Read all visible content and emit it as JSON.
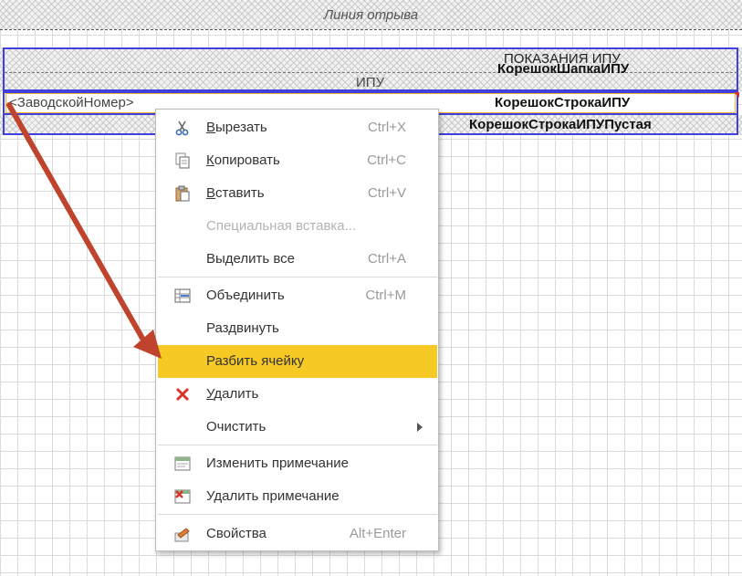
{
  "sheet": {
    "tear_line": "Линия отрыва",
    "header_title": "ПОКАЗАНИЯ ИПУ",
    "header_area": "КорешокШапкаИПУ",
    "header_sub": "ИПУ",
    "row_param": "<ЗаводскойНомер>",
    "row_area": "КорешокСтрокаИПУ",
    "empty_area": "КорешокСтрокаИПУПустая"
  },
  "menu": {
    "items": [
      {
        "label_u": "В",
        "label_rest": "ырезать",
        "shortcut": "Ctrl+X",
        "icon": "scissors-icon"
      },
      {
        "label_u": "К",
        "label_rest": "опировать",
        "shortcut": "Ctrl+C",
        "icon": "copy-icon"
      },
      {
        "label_u": "В",
        "label_rest": "ставить",
        "shortcut": "Ctrl+V",
        "icon": "paste-icon"
      },
      {
        "label": "Специальная вставка...",
        "shortcut": ""
      },
      {
        "label": "Выделить все",
        "shortcut": "Ctrl+A"
      },
      {
        "label": "Объединить",
        "shortcut": "Ctrl+M",
        "icon": "merge-cells-icon"
      },
      {
        "label": "Раздвинуть",
        "shortcut": ""
      },
      {
        "label": "Разбить ячейку",
        "shortcut": ""
      },
      {
        "label_u": "У",
        "label_rest": "далить",
        "shortcut": "",
        "icon": "delete-icon"
      },
      {
        "label": "Очистить",
        "shortcut": ""
      },
      {
        "label": "Изменить примечание",
        "shortcut": "",
        "icon": "edit-note-icon"
      },
      {
        "label": "Удалить примечание",
        "shortcut": "",
        "icon": "delete-note-icon"
      },
      {
        "label": "Свойства",
        "shortcut": "Alt+Enter",
        "icon": "properties-icon"
      }
    ]
  },
  "colors": {
    "highlight": "#f6c924",
    "arrow": "#c0392b",
    "section_border": "#4040e0"
  }
}
